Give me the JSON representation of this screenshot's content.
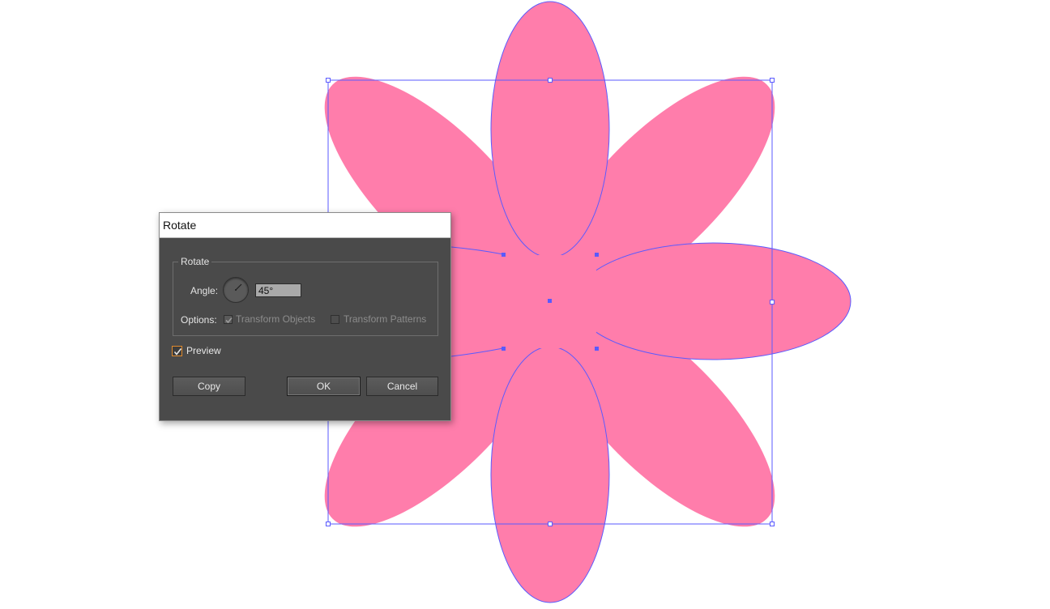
{
  "dialog": {
    "title": "Rotate",
    "group_label": "Rotate",
    "angle_label": "Angle:",
    "angle_value": "45°",
    "options_label": "Options:",
    "transform_objects_label": "Transform Objects",
    "transform_objects_checked": true,
    "transform_patterns_label": "Transform Patterns",
    "transform_patterns_checked": false,
    "preview_label": "Preview",
    "preview_checked": true,
    "copy_label": "Copy",
    "ok_label": "OK",
    "cancel_label": "Cancel"
  },
  "artwork": {
    "shape": "eight-petal-flower",
    "fill_color": "#ff7dab",
    "selection_color": "#5a5aff"
  }
}
